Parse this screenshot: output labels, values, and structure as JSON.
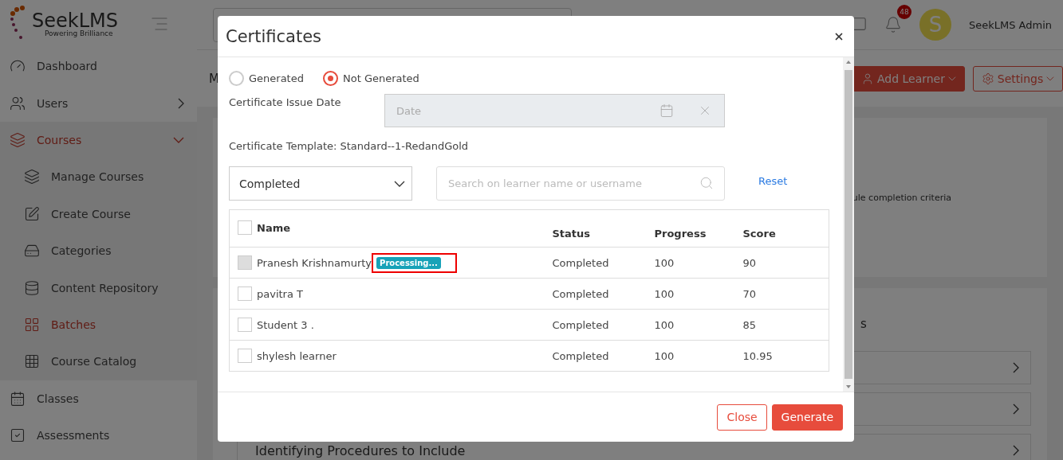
{
  "sidebar": {
    "logo": {
      "name": "SeekLMS",
      "tagline": "Powering Brilliance"
    },
    "items": [
      {
        "label": "Dashboard",
        "kind": "dashboard",
        "selected": false
      },
      {
        "label": "Users",
        "kind": "users",
        "selected": false,
        "expanded": false
      },
      {
        "label": "Courses",
        "kind": "courses",
        "selected": true,
        "expanded": true,
        "children": [
          {
            "label": "Manage Courses",
            "kind": "manage",
            "selected": false
          },
          {
            "label": "Create Course",
            "kind": "create",
            "selected": false
          },
          {
            "label": "Categories",
            "kind": "categories",
            "selected": false
          },
          {
            "label": "Content Repository",
            "kind": "repository",
            "selected": false
          },
          {
            "label": "Batches",
            "kind": "batches",
            "selected": true
          },
          {
            "label": "Course Catalog",
            "kind": "catalog",
            "selected": false
          }
        ]
      },
      {
        "label": "Classes",
        "kind": "classes",
        "selected": false
      },
      {
        "label": "Assessments",
        "kind": "assessments",
        "selected": false
      }
    ]
  },
  "topbar": {
    "notifications": "48",
    "avatar": "S",
    "user": "SeekLMS Admin"
  },
  "page": {
    "title": "M",
    "actions": [
      {
        "label": "Add Learner",
        "kind": "primary"
      },
      {
        "label": "Settings",
        "kind": "outline"
      }
    ],
    "criteria_text": "ule completion criteria",
    "side_text": "s",
    "modules": [
      {
        "kind": "row"
      },
      {
        "kind": "row"
      },
      {
        "kind": "row",
        "title": "Identifying Procedures to Include"
      }
    ]
  },
  "dialog": {
    "title": "Certificates",
    "filters": [
      {
        "label": "Generated",
        "selected": false
      },
      {
        "label": "Not Generated",
        "selected": true
      }
    ],
    "issue_date": {
      "label": "Certificate Issue Date",
      "placeholder": "Date",
      "disabled": true
    },
    "template": "Certificate Template: Standard--1-RedandGold",
    "status_filter": "Completed",
    "search": {
      "placeholder": "Search on learner name or username"
    },
    "reset": "Reset",
    "table": {
      "columns": [
        "Name",
        "Status",
        "Progress",
        "Score"
      ],
      "select_all_checked": false,
      "rows": [
        {
          "name": "Pranesh Krishnamurty",
          "badge": "Processing...",
          "highlighted": true,
          "disabled": true,
          "checked": false,
          "status": "Completed",
          "progress": "100",
          "score": "90"
        },
        {
          "name": "pavitra T",
          "disabled": false,
          "checked": false,
          "status": "Completed",
          "progress": "100",
          "score": "70"
        },
        {
          "name": "Student 3 .",
          "disabled": false,
          "checked": false,
          "status": "Completed",
          "progress": "100",
          "score": "85"
        },
        {
          "name": "shylesh learner",
          "disabled": false,
          "checked": false,
          "status": "Completed",
          "progress": "100",
          "score": "10.95"
        }
      ]
    },
    "buttons": [
      {
        "label": "Close",
        "kind": "outline"
      },
      {
        "label": "Generate",
        "kind": "primary"
      }
    ]
  }
}
